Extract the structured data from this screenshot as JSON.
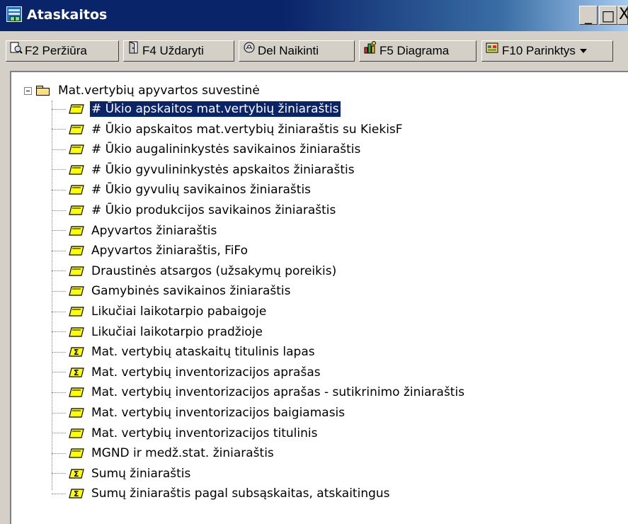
{
  "window": {
    "title": "Ataskaitos",
    "minimize_glyph": "_",
    "maximize_glyph": "□",
    "close_glyph": "X"
  },
  "toolbar": {
    "preview_label": "F2 Peržiūra",
    "close_label": "F4 Uždaryti",
    "delete_label": "Del Naikinti",
    "chart_label": "F5 Diagrama",
    "options_label": "F10 Parinktys"
  },
  "tree": {
    "root_label": "Mat.vertybių apyvartos suvestinė",
    "items": [
      {
        "label": "# Ūkio apskaitos mat.vertybių žiniaraštis",
        "icon": "report-icon",
        "selected": true
      },
      {
        "label": "# Ūkio apskaitos mat.vertybių žiniaraštis su KiekisF",
        "icon": "report-icon"
      },
      {
        "label": "# Ūkio augalininkystės savikainos žiniaraštis",
        "icon": "report-icon"
      },
      {
        "label": "# Ūkio gyvulininkystės apskaitos žiniaraštis",
        "icon": "report-icon"
      },
      {
        "label": "# Ūkio gyvulių savikainos žiniaraštis",
        "icon": "report-icon"
      },
      {
        "label": "# Ūkio produkcijos savikainos žiniaraštis",
        "icon": "report-icon"
      },
      {
        "label": "Apyvartos žiniaraštis",
        "icon": "report-icon"
      },
      {
        "label": "Apyvartos žiniaraštis, FiFo",
        "icon": "report-icon"
      },
      {
        "label": "Draustinės atsargos (užsakymų poreikis)",
        "icon": "report-icon"
      },
      {
        "label": "Gamybinės savikainos žiniaraštis",
        "icon": "report-icon"
      },
      {
        "label": "Likučiai laikotarpio pabaigoje",
        "icon": "report-icon"
      },
      {
        "label": "Likučiai laikotarpio pradžioje",
        "icon": "report-icon"
      },
      {
        "label": "Mat. vertybių ataskaitų titulinis lapas",
        "icon": "sum-report-icon"
      },
      {
        "label": "Mat. vertybių inventorizacijos aprašas",
        "icon": "sum-report-icon"
      },
      {
        "label": "Mat. vertybių inventorizacijos aprašas - sutikrinimo žiniaraštis",
        "icon": "report-icon"
      },
      {
        "label": "Mat. vertybių inventorizacijos baigiamasis",
        "icon": "report-icon"
      },
      {
        "label": "Mat. vertybių inventorizacijos titulinis",
        "icon": "report-icon"
      },
      {
        "label": "MGND ir medž.stat. žiniaraštis",
        "icon": "report-icon"
      },
      {
        "label": "Sumų žiniaraštis",
        "icon": "sum-report-icon"
      },
      {
        "label": "Sumų žiniaraštis pagal subsąskaitas, atskaitingus",
        "icon": "sum-report-icon"
      }
    ]
  },
  "colors": {
    "title_bar": "#0a246a",
    "selection": "#0a246a",
    "report_icon_fill": "#ffff00"
  }
}
